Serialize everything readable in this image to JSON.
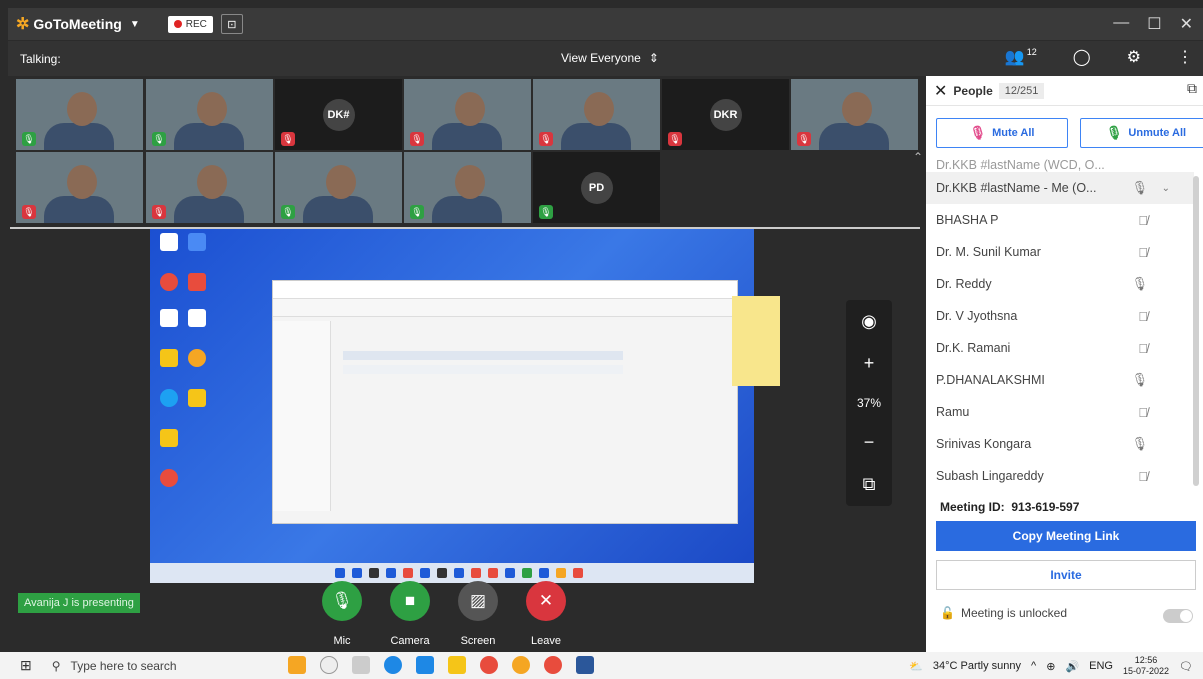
{
  "titlebar": {
    "app_name": "GoToMeeting",
    "rec_label": "REC"
  },
  "toolbar": {
    "talking_label": "Talking:",
    "view_label": "View Everyone",
    "people_count": "12"
  },
  "tiles": [
    {
      "initials": "",
      "mic": "on",
      "video": true
    },
    {
      "initials": "",
      "mic": "on",
      "video": true
    },
    {
      "initials": "DK#",
      "mic": "off",
      "video": false
    },
    {
      "initials": "",
      "mic": "off",
      "video": true
    },
    {
      "initials": "",
      "mic": "off",
      "video": true
    },
    {
      "initials": "DKR",
      "mic": "off",
      "video": false
    },
    {
      "initials": "",
      "mic": "off",
      "video": true
    },
    {
      "initials": "",
      "mic": "off",
      "video": true
    },
    {
      "initials": "",
      "mic": "off",
      "video": true
    },
    {
      "initials": "",
      "mic": "on",
      "video": true
    },
    {
      "initials": "",
      "mic": "on",
      "video": true
    },
    {
      "initials": "PD",
      "mic": "on",
      "video": false
    }
  ],
  "stage": {
    "zoom": "37%",
    "presenting_text": "Avanija J is presenting"
  },
  "controls": [
    {
      "label": "Mic",
      "icon": "mic-icon",
      "color": "#2ea043"
    },
    {
      "label": "Camera",
      "icon": "camera-icon",
      "color": "#2ea043"
    },
    {
      "label": "Screen",
      "icon": "screen-share-icon",
      "color": "#555"
    },
    {
      "label": "Leave",
      "icon": "close-icon",
      "color": "#d9363e"
    }
  ],
  "people": {
    "title": "People",
    "count": "12/251",
    "mute_all": "Mute All",
    "unmute_all": "Unmute All",
    "partial_item": "Dr.KKB #lastName (WCD, O...",
    "items": [
      {
        "name": "Dr.KKB #lastName  - Me (O...",
        "mic": "on",
        "me": true
      },
      {
        "name": "BHASHA P",
        "mic": "off"
      },
      {
        "name": "Dr. M. Sunil Kumar",
        "mic": "off"
      },
      {
        "name": "Dr. Reddy",
        "mic": "on"
      },
      {
        "name": "Dr. V Jyothsna",
        "mic": "off"
      },
      {
        "name": "Dr.K. Ramani",
        "mic": "off"
      },
      {
        "name": "P.DHANALAKSHMI",
        "mic": "on"
      },
      {
        "name": "Ramu",
        "mic": "off"
      },
      {
        "name": "Srinivas Kongara",
        "mic": "on"
      },
      {
        "name": "Subash Lingareddy",
        "mic": "off"
      }
    ],
    "meeting_id_label": "Meeting ID:",
    "meeting_id": "913-619-597",
    "copy_link": "Copy Meeting Link",
    "invite": "Invite",
    "lock_status": "Meeting is unlocked"
  },
  "taskbar": {
    "search_placeholder": "Type here to search",
    "weather": "34°C  Partly sunny",
    "lang": "ENG",
    "time": "12:56",
    "date": "15-07-2022"
  }
}
